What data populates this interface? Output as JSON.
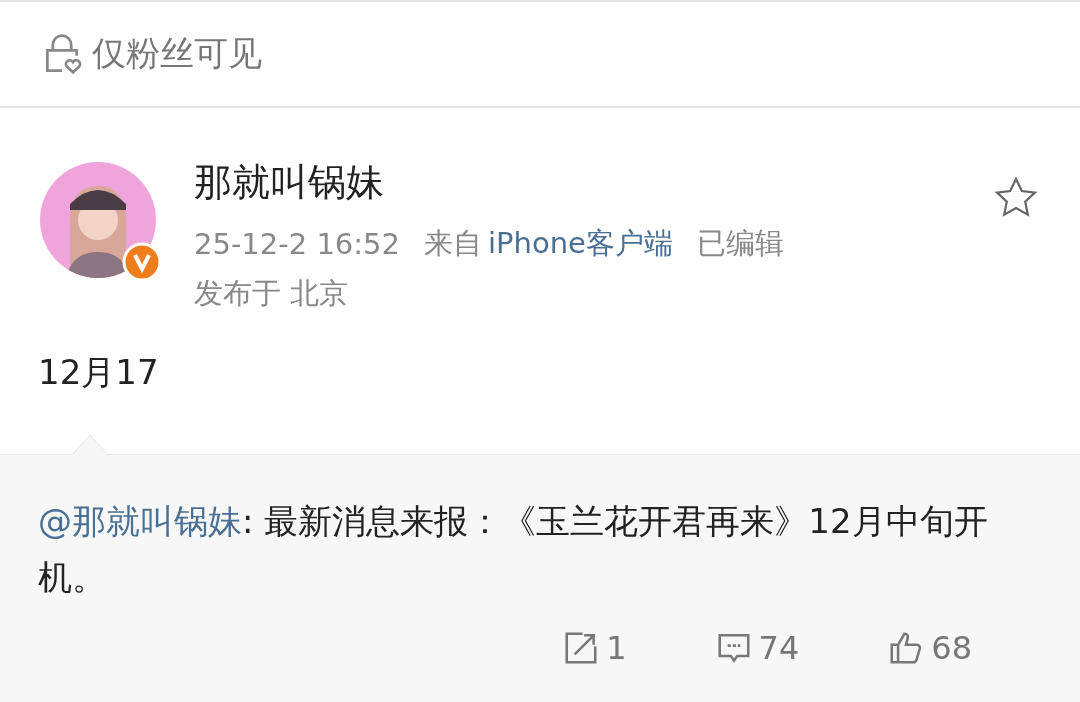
{
  "visibility": {
    "label": "仅粉丝可见"
  },
  "post": {
    "author": "那就叫锅妹",
    "verified": true,
    "time": "25-12-2 16:52",
    "source_prefix": "来自",
    "source": "iPhone客户端",
    "edited": "已编辑",
    "location": "发布于 北京",
    "text": "12月17"
  },
  "retweet": {
    "mention": "@那就叫锅妹",
    "text": ": 最新消息来报：《玉兰花开君再来》12月中旬开机。"
  },
  "actions": [
    {
      "kind": "repost",
      "count": "1"
    },
    {
      "kind": "comment",
      "count": "74"
    },
    {
      "kind": "like",
      "count": "68"
    }
  ]
}
